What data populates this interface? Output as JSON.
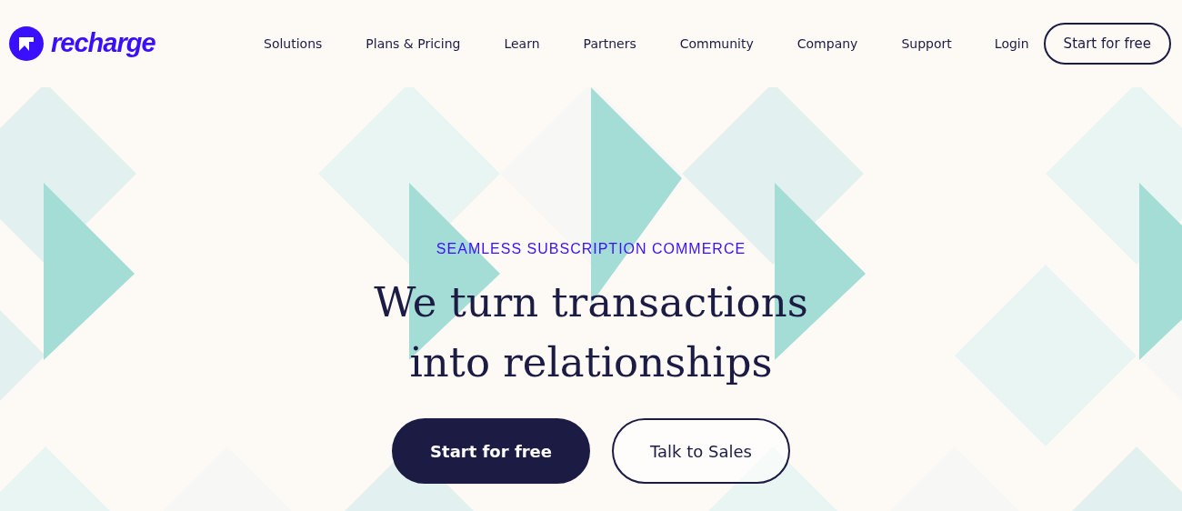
{
  "header": {
    "logo": {
      "text": "recharge"
    },
    "nav": [
      "Solutions",
      "Plans & Pricing",
      "Learn",
      "Partners",
      "Community",
      "Company",
      "Support"
    ],
    "login": "Login",
    "cta": "Start for free"
  },
  "hero": {
    "eyebrow": "SEAMLESS SUBSCRIPTION COMMERCE",
    "title_lines": [
      "We turn transactions",
      "into relationships"
    ],
    "buttons": [
      {
        "label": "Start for free",
        "kind": "primary"
      },
      {
        "label": "Talk to Sales",
        "kind": "outline"
      }
    ]
  }
}
